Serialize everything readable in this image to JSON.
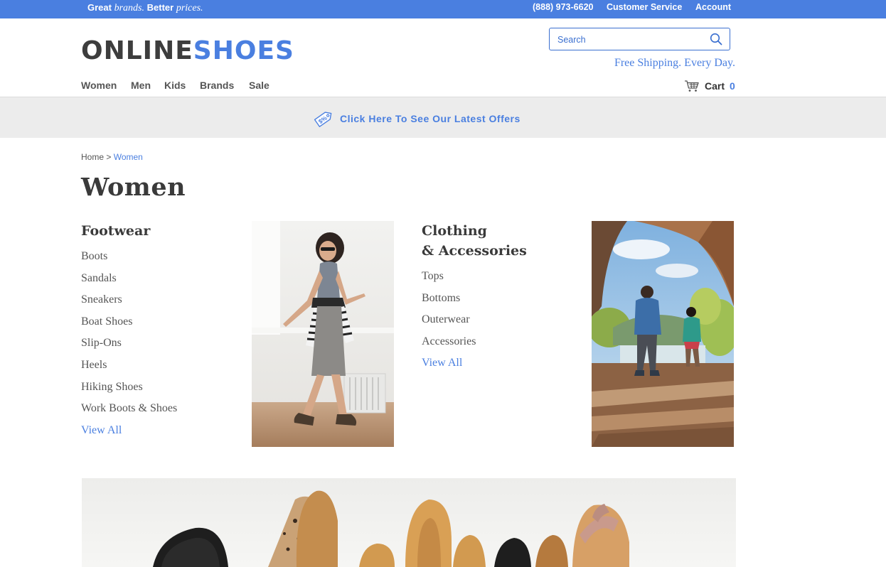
{
  "topbar": {
    "tagline_great": "Great",
    "tagline_brands": "brands.",
    "tagline_better": "Better",
    "tagline_prices": "prices.",
    "phone": "(888) 973-6620",
    "customer_service": "Customer Service",
    "account": "Account",
    "color": "#4a7fe0"
  },
  "header": {
    "logo_part1": "ONLINE",
    "logo_part2": "SHOES",
    "search_placeholder": "Search",
    "free_shipping": "Free Shipping. Every Day.",
    "nav": [
      "Women",
      "Men",
      "Kids",
      "Brands",
      "Sale"
    ],
    "cart_label": "Cart",
    "cart_count": "0"
  },
  "offer": {
    "text": "Click Here To See Our Latest Offers"
  },
  "breadcrumb": {
    "home": "Home",
    "separator": ">",
    "current": "Women"
  },
  "page_title": "Women",
  "footwear": {
    "heading": "Footwear",
    "links": [
      "Boots",
      "Sandals",
      "Sneakers",
      "Boat Shoes",
      "Slip-Ons",
      "Heels",
      "Hiking Shoes",
      "Work Boots & Shoes"
    ],
    "view_all": "View All"
  },
  "clothing": {
    "heading_line1": "Clothing",
    "heading_line2": "& Accessories",
    "links": [
      "Tops",
      "Bottoms",
      "Outerwear",
      "Accessories"
    ],
    "view_all": "View All"
  },
  "colors": {
    "accent": "#4a7fe0",
    "heading": "#3a3a3a",
    "strip": "#ececec"
  }
}
